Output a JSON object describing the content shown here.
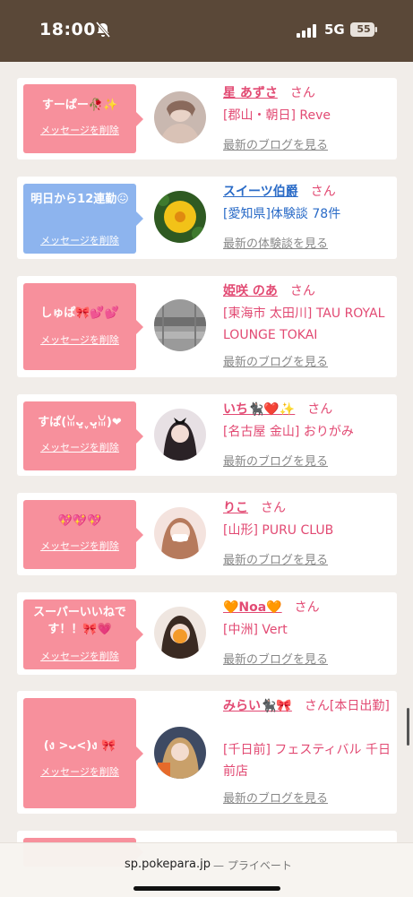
{
  "status_bar": {
    "time": "18:00",
    "network": "5G",
    "battery": "55"
  },
  "labels": {
    "delete": "メッセージを削除",
    "san": "さん"
  },
  "items": [
    {
      "message": "すーぱー🥀✨",
      "name": "星 あずさ",
      "info": "[郡山・朝日] Reve",
      "link": "最新のブログを見る"
    },
    {
      "message": "明日から12連勤😖",
      "name": "スイーツ伯爵",
      "info": "[愛知県]体験談 78件",
      "link": "最新の体験談を見る"
    },
    {
      "message": "しゅぱ🎀💕💕",
      "name": "姫咲 のあ",
      "info": "[東海市 太田川] TAU ROYAL LOUNGE TOKAI",
      "link": "最新のブログを見る"
    },
    {
      "message": "すぱ(ꈍᴗ͈ˬᴗ͈ꈍ)❤",
      "name": "いち🐈‍⬛❤️✨",
      "info": "[名古屋 金山] おりがみ",
      "link": "最新のブログを見る"
    },
    {
      "message": "💖💖💖",
      "name": "りこ",
      "info": "[山形] PURU CLUB",
      "link": "最新のブログを見る"
    },
    {
      "message": "スーパーいいねです！！🎀💗",
      "name": "🧡Noa🧡",
      "info": "[中洲] Vert",
      "link": "最新のブログを見る"
    },
    {
      "message": "(ง >ᴗ<)ง 🎀",
      "name": "みらい🐈‍⬛🎀",
      "suffix": "[本日出勤]",
      "info": "[千日前] フェスティバル 千日前店",
      "link": "最新のブログを見る"
    }
  ],
  "footer": {
    "host": "sp.pokepara.jp",
    "private": "— プライベート"
  }
}
